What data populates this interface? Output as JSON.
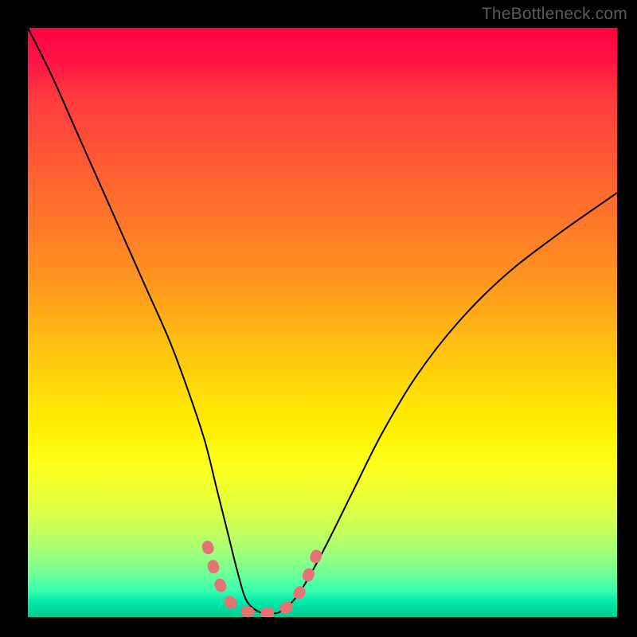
{
  "watermark": "TheBottleneck.com",
  "chart_data": {
    "type": "line",
    "title": "",
    "xlabel": "",
    "ylabel": "",
    "xlim": [
      0,
      100
    ],
    "ylim": [
      0,
      100
    ],
    "series": [
      {
        "name": "bottleneck-curve",
        "x": [
          0,
          4,
          8,
          12,
          16,
          20,
          24,
          27,
          30,
          32,
          34,
          35.5,
          37,
          39,
          41,
          43,
          46,
          50,
          55,
          60,
          66,
          73,
          81,
          90,
          100
        ],
        "y": [
          100,
          92,
          83,
          74,
          65,
          56,
          47,
          39,
          30,
          22,
          14,
          8,
          3,
          1,
          0.7,
          1,
          4,
          11,
          21,
          31,
          41,
          50,
          58,
          65,
          72
        ]
      },
      {
        "name": "optimal-range-marker",
        "x": [
          30.5,
          32,
          34,
          36,
          38,
          40,
          42,
          44,
          46,
          48,
          49.5
        ],
        "y": [
          12,
          7,
          3,
          1.3,
          0.8,
          0.7,
          0.9,
          1.7,
          4,
          8,
          12
        ]
      }
    ],
    "colors": {
      "curve": "#000000",
      "marker": "#e57373",
      "gradient_top": "#ff0040",
      "gradient_mid": "#fff000",
      "gradient_bottom": "#00cc92"
    }
  }
}
